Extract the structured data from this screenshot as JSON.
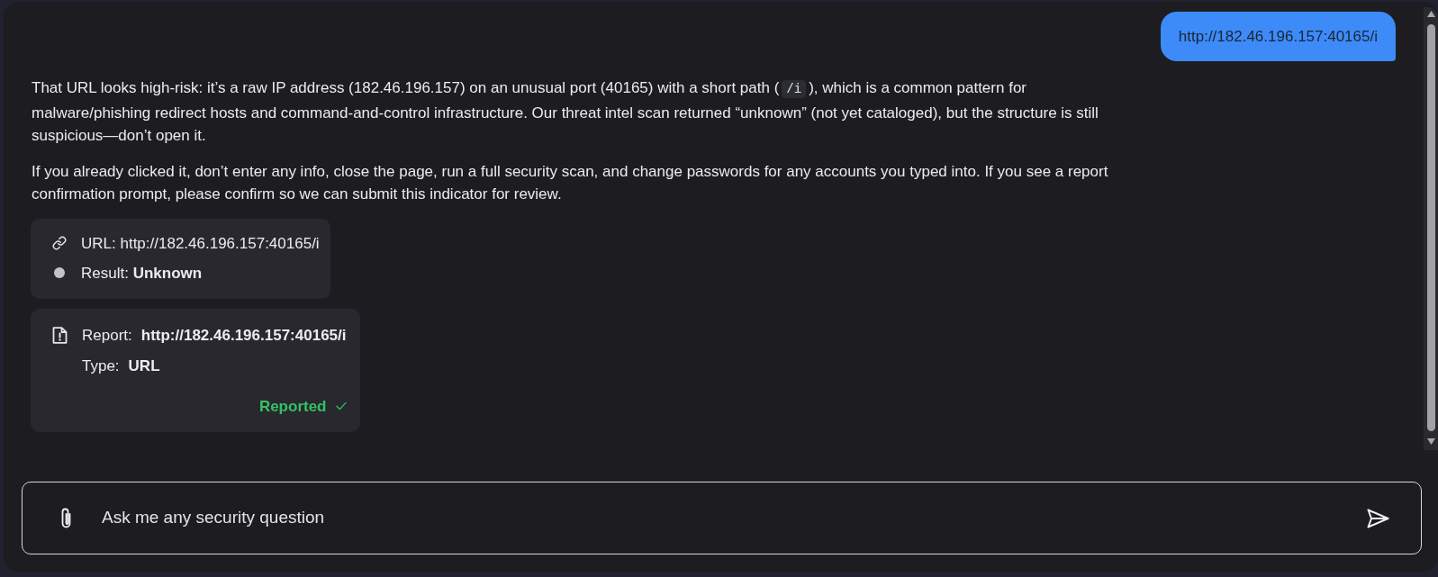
{
  "conversation": [
    {
      "kind": "user",
      "text": "http://182.46.196.157:40165/i"
    },
    {
      "kind": "assistant",
      "blocks": [
        {
          "kind": "paragraph",
          "parts": [
            {
              "kind": "text",
              "text": "That URL looks high-risk: it’s a raw IP address (182.46.196.157) on an unusual port (40165) with a short path ("
            },
            {
              "kind": "code",
              "text": "/i"
            },
            {
              "kind": "text",
              "text": "), which is a common pattern for malware/phishing redirect hosts and command-and-control infrastructure. Our threat intel scan returned “unknown” (not yet cataloged), but the structure is still suspicious—don’t open it."
            }
          ]
        },
        {
          "kind": "paragraph",
          "parts": [
            {
              "kind": "text",
              "text": "If you already clicked it, don’t enter any info, close the page, run a full security scan, and change passwords for any accounts you typed into. If you see a report confirmation prompt, please confirm so we can submit this indicator for review."
            }
          ]
        },
        {
          "kind": "scan_card",
          "url": "URL: http://182.46.196.157:40165/i",
          "result": "Result: **Unknown**"
        },
        {
          "kind": "report_card",
          "rows": [
            {
              "label": "Report:",
              "value": "http://182.46.196.157:40165/i"
            },
            {
              "label": "Type:",
              "value": "URL"
            }
          ],
          "status": "Reported",
          "reported": true
        }
      ]
    }
  ],
  "composer": {
    "placeholder": "Ask me any security question"
  }
}
